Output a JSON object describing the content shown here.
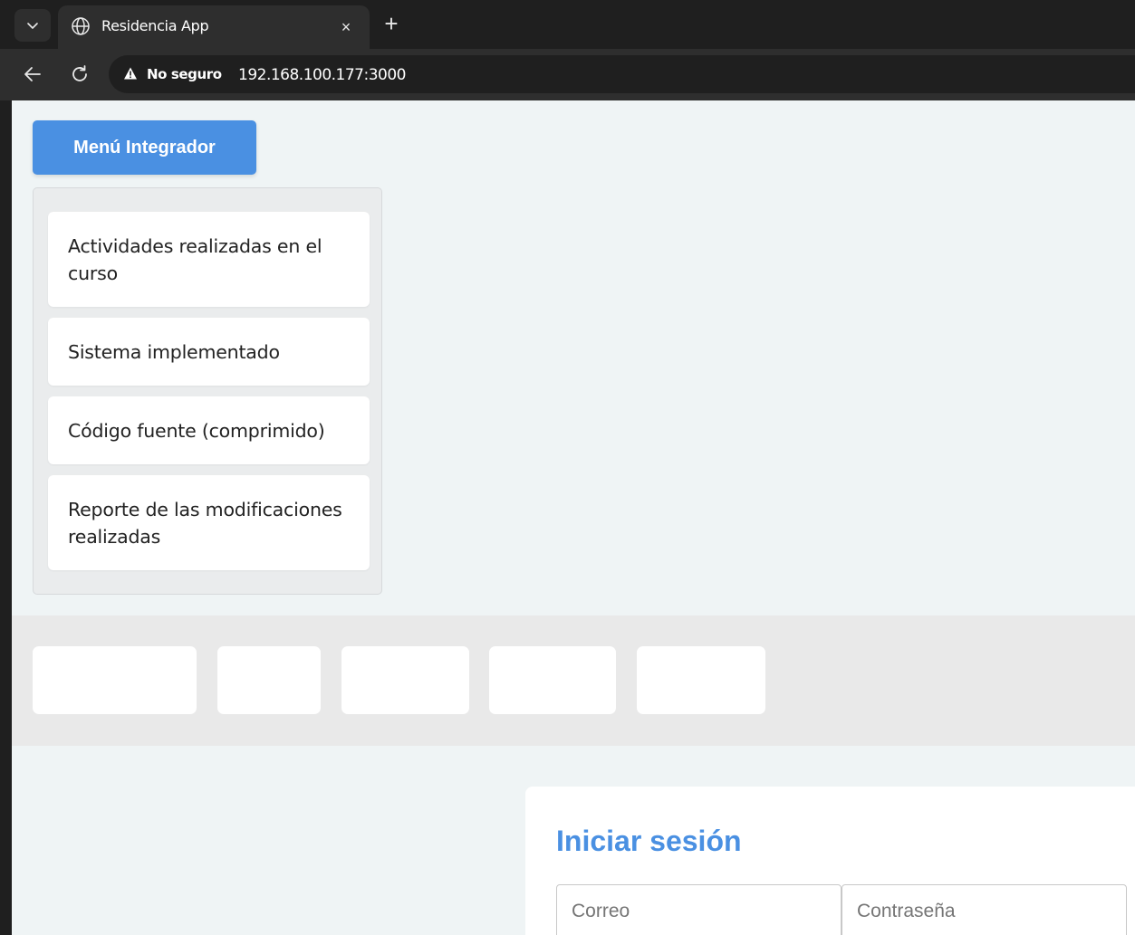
{
  "browser": {
    "tab": {
      "title": "Residencia App",
      "close_glyph": "×"
    },
    "new_tab_glyph": "+",
    "security_label": "No seguro",
    "url": "192.168.100.177:3000",
    "icons": [
      "chevron-down-icon",
      "globe-icon",
      "close-icon",
      "plus-icon",
      "back-arrow-icon",
      "reload-icon",
      "warning-icon"
    ]
  },
  "menu": {
    "toggle_label": "Menú Integrador",
    "items": [
      {
        "label": "Actividades realizadas en el curso"
      },
      {
        "label": "Sistema implementado"
      },
      {
        "label": "Código fuente (comprimido)"
      },
      {
        "label": "Reporte de las modificaciones realizadas"
      }
    ]
  },
  "login": {
    "title": "Iniciar sesión",
    "email_placeholder": "Correo",
    "password_placeholder": "Contraseña"
  },
  "colors": {
    "accent": "#4a90e2",
    "page_background": "#eff4f5",
    "chrome_dark": "#1f1f1f",
    "chrome_toolbar": "#2e2e2e"
  }
}
